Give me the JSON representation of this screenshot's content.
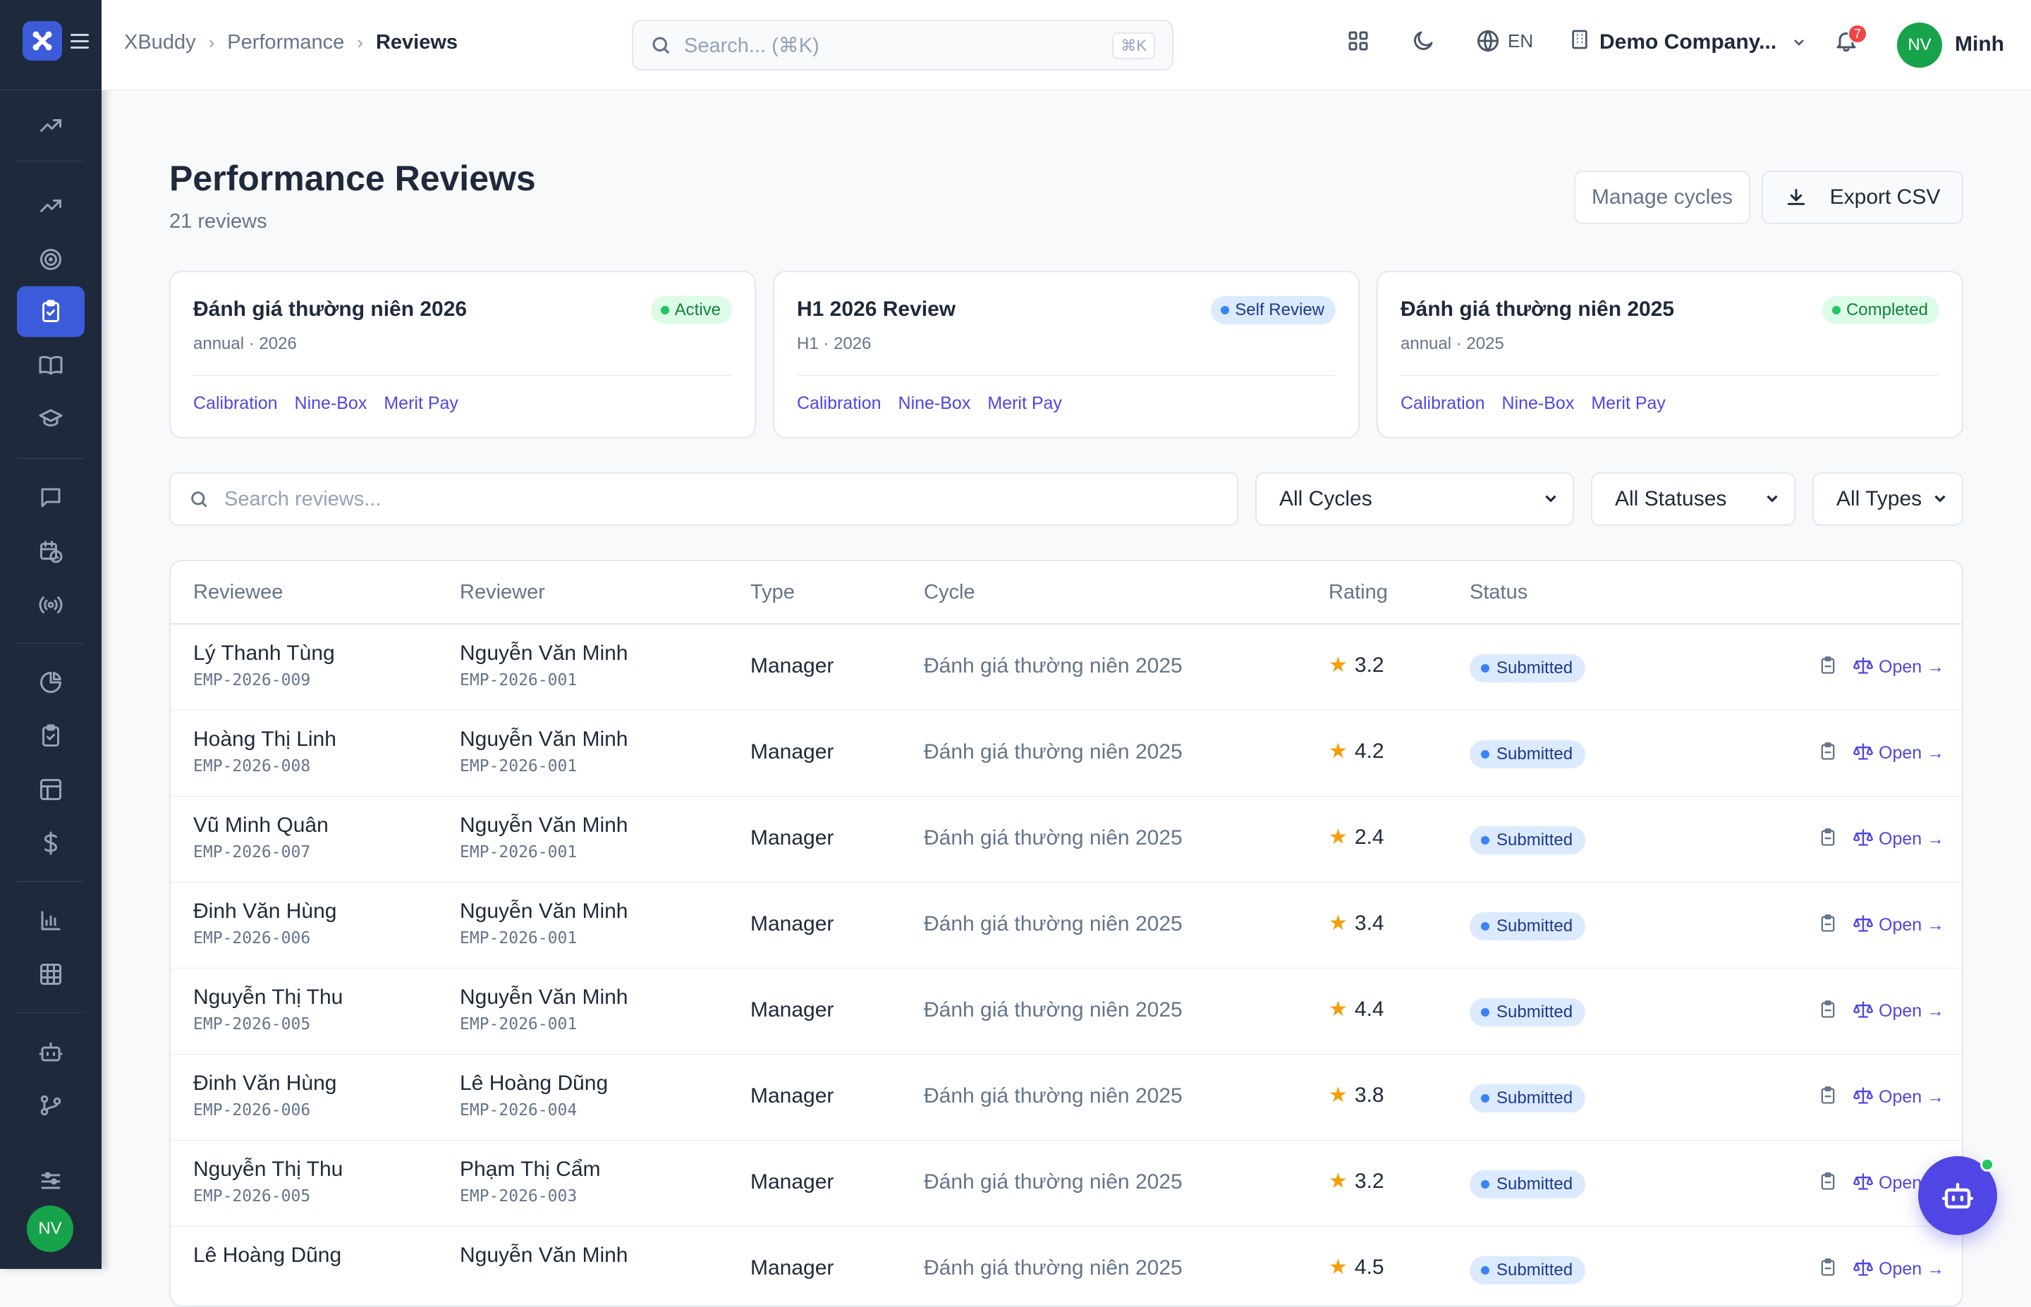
{
  "breadcrumb": [
    "XBuddy",
    "Performance",
    "Reviews"
  ],
  "search": {
    "placeholder": "Search... (⌘K)",
    "shortcut": "⌘K"
  },
  "topbar": {
    "lang": "EN",
    "company": "Demo Company...",
    "notifications": "7",
    "user_initials": "NV",
    "user_name": "Minh"
  },
  "sidebar": {
    "icons": [
      "trend-icon",
      "trend-icon",
      "target-icon",
      "clipboard-check-icon",
      "book-icon",
      "graduation-cap-icon",
      "message-icon",
      "calendar-clock-icon",
      "broadcast-icon",
      "pie-chart-icon",
      "clipboard-icon",
      "layout-icon",
      "dollar-icon",
      "bar-chart-icon",
      "grid-icon",
      "bot-icon",
      "git-branch-icon",
      "sliders-icon"
    ],
    "avatar": "NV"
  },
  "page": {
    "title": "Performance Reviews",
    "subtitle": "21 reviews",
    "manage_label": "Manage cycles",
    "export_label": "Export CSV"
  },
  "cycles": [
    {
      "name": "Đánh giá thường niên 2026",
      "meta": "annual · 2026",
      "status": "Active",
      "links": [
        "Calibration",
        "Nine-Box",
        "Merit Pay"
      ]
    },
    {
      "name": "H1 2026 Review",
      "meta": "H1 · 2026",
      "status": "Self Review",
      "links": [
        "Calibration",
        "Nine-Box",
        "Merit Pay"
      ]
    },
    {
      "name": "Đánh giá thường niên 2025",
      "meta": "annual · 2025",
      "status": "Completed",
      "links": [
        "Calibration",
        "Nine-Box",
        "Merit Pay"
      ]
    }
  ],
  "filters": {
    "search_placeholder": "Search reviews...",
    "cycle": "All Cycles",
    "status": "All Statuses",
    "type": "All Types"
  },
  "table": {
    "headers": [
      "Reviewee",
      "Reviewer",
      "Type",
      "Cycle",
      "Rating",
      "Status"
    ],
    "open_label": "Open →",
    "rows": [
      {
        "reviewee": "Lý Thanh Tùng",
        "reviewee_id": "EMP-2026-009",
        "reviewer": "Nguyễn Văn Minh",
        "reviewer_id": "EMP-2026-001",
        "type": "Manager",
        "cycle": "Đánh giá thường niên 2025",
        "rating": "3.2",
        "status": "Submitted"
      },
      {
        "reviewee": "Hoàng Thị Linh",
        "reviewee_id": "EMP-2026-008",
        "reviewer": "Nguyễn Văn Minh",
        "reviewer_id": "EMP-2026-001",
        "type": "Manager",
        "cycle": "Đánh giá thường niên 2025",
        "rating": "4.2",
        "status": "Submitted"
      },
      {
        "reviewee": "Vũ Minh Quân",
        "reviewee_id": "EMP-2026-007",
        "reviewer": "Nguyễn Văn Minh",
        "reviewer_id": "EMP-2026-001",
        "type": "Manager",
        "cycle": "Đánh giá thường niên 2025",
        "rating": "2.4",
        "status": "Submitted"
      },
      {
        "reviewee": "Đinh Văn Hùng",
        "reviewee_id": "EMP-2026-006",
        "reviewer": "Nguyễn Văn Minh",
        "reviewer_id": "EMP-2026-001",
        "type": "Manager",
        "cycle": "Đánh giá thường niên 2025",
        "rating": "3.4",
        "status": "Submitted"
      },
      {
        "reviewee": "Nguyễn Thị Thu",
        "reviewee_id": "EMP-2026-005",
        "reviewer": "Nguyễn Văn Minh",
        "reviewer_id": "EMP-2026-001",
        "type": "Manager",
        "cycle": "Đánh giá thường niên 2025",
        "rating": "4.4",
        "status": "Submitted"
      },
      {
        "reviewee": "Đinh Văn Hùng",
        "reviewee_id": "EMP-2026-006",
        "reviewer": "Lê Hoàng Dũng",
        "reviewer_id": "EMP-2026-004",
        "type": "Manager",
        "cycle": "Đánh giá thường niên 2025",
        "rating": "3.8",
        "status": "Submitted"
      },
      {
        "reviewee": "Nguyễn Thị Thu",
        "reviewee_id": "EMP-2026-005",
        "reviewer": "Phạm Thị Cẩm",
        "reviewer_id": "EMP-2026-003",
        "type": "Manager",
        "cycle": "Đánh giá thường niên 2025",
        "rating": "3.2",
        "status": "Submitted"
      },
      {
        "reviewee": "Lê Hoàng Dũng",
        "reviewee_id": "",
        "reviewer": "Nguyễn Văn Minh",
        "reviewer_id": "",
        "type": "Manager",
        "cycle": "Đánh giá thường niên 2025",
        "rating": "4.5",
        "status": "Submitted"
      }
    ]
  },
  "colors": {
    "accent": "#4f46e5",
    "sidebar_bg": "#1e2a3b",
    "active_pill": "#dcfce7",
    "self_review_pill": "#dbeafe",
    "status_blue": "#3b82f6",
    "star": "#f59e0b"
  }
}
